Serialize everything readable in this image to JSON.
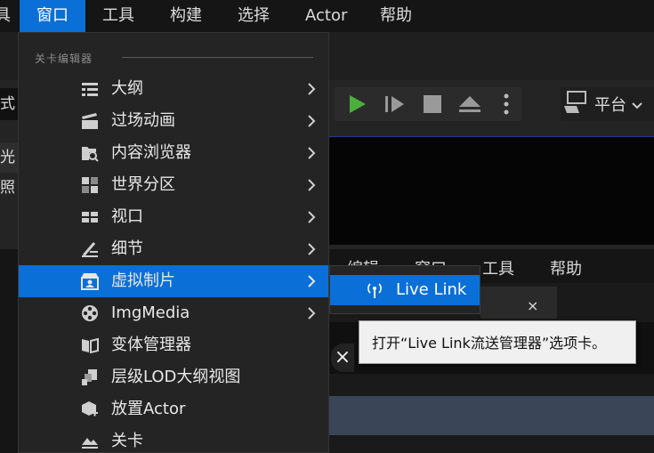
{
  "menubar": {
    "left_fragment": "具",
    "items": [
      "窗口",
      "工具",
      "构建",
      "选择",
      "Actor",
      "帮助"
    ],
    "active": "窗口"
  },
  "background": {
    "left_fragment_1": "式",
    "left_fragment_2": "光照",
    "platform_label": "平台",
    "lower_menu": [
      "编辑",
      "窗口",
      "工具",
      "帮助"
    ],
    "tab_close": "×",
    "close_glyph": "×"
  },
  "dropdown": {
    "section_header": "关卡编辑器",
    "items": [
      {
        "label": "大纲",
        "icon": "outliner-icon",
        "submenu": true
      },
      {
        "label": "过场动画",
        "icon": "clapperboard-icon",
        "submenu": true
      },
      {
        "label": "内容浏览器",
        "icon": "content-browser-icon",
        "submenu": true
      },
      {
        "label": "世界分区",
        "icon": "world-partition-icon",
        "submenu": true
      },
      {
        "label": "视口",
        "icon": "viewport-icon",
        "submenu": true
      },
      {
        "label": "细节",
        "icon": "details-icon",
        "submenu": true
      },
      {
        "label": "虚拟制片",
        "icon": "virtual-production-icon",
        "submenu": true,
        "active": true
      },
      {
        "label": "ImgMedia",
        "icon": "film-reel-icon",
        "submenu": true
      },
      {
        "label": "变体管理器",
        "icon": "variant-manager-icon",
        "submenu": false
      },
      {
        "label": "层级LOD大纲视图",
        "icon": "hlod-outliner-icon",
        "submenu": false
      },
      {
        "label": "放置Actor",
        "icon": "place-actor-icon",
        "submenu": false
      },
      {
        "label": "关卡",
        "icon": "levels-icon",
        "submenu": false
      }
    ]
  },
  "submenu": {
    "label": "Live Link",
    "icon": "live-link-icon"
  },
  "tooltip": {
    "text": "打开“Live Link流送管理器”选项卡。"
  },
  "colors": {
    "accent": "#0a6fd6",
    "play_green": "#4caf3c",
    "menu_bg": "#242424"
  }
}
